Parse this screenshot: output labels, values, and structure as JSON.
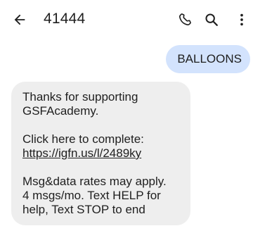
{
  "header": {
    "title": "41444",
    "back_icon": "arrow-back-icon",
    "call_icon": "phone-icon",
    "search_icon": "search-icon",
    "more_icon": "more-vert-icon"
  },
  "messages": {
    "outgoing": {
      "text": "BALLOONS"
    },
    "incoming": {
      "line1": "Thanks for supporting",
      "line2": "GSFAcademy.",
      "click_text": "Click here to complete:",
      "link": "https://igfn.us/l/2489ky",
      "rates_line1": "Msg&data rates may apply.",
      "rates_line2": "4 msgs/mo. Text HELP for",
      "rates_line3": "help, Text STOP to end"
    }
  },
  "colors": {
    "outgoing_bubble": "#d3e3fd",
    "incoming_bubble": "#eeeeee",
    "text": "#1f1f1f"
  }
}
